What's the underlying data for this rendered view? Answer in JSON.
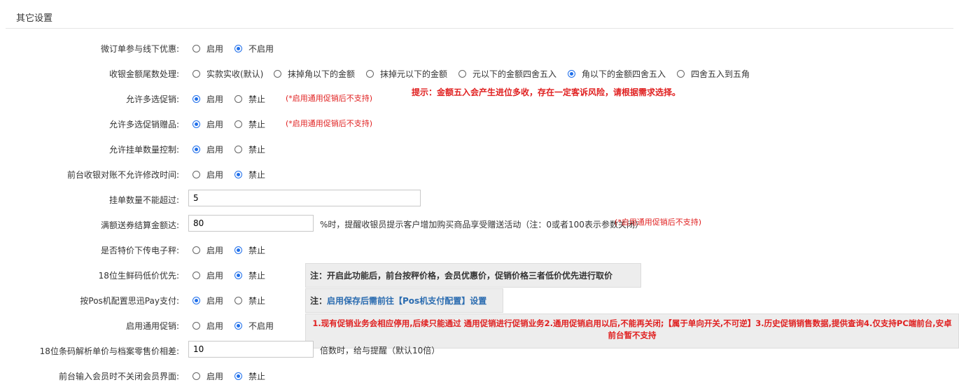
{
  "section": {
    "title": "其它设置"
  },
  "colors": {
    "accent": "#1f6feb",
    "warning": "#e02020",
    "note_bg": "#ededed",
    "link": "#2b6cb0"
  },
  "rows": {
    "weiding": {
      "label": "微订单参与线下优惠:",
      "opt1": "启用",
      "opt2": "不启用"
    },
    "rounding": {
      "label": "收银金额尾数处理:",
      "opt1": "实款实收(默认)",
      "opt2": "抹掉角以下的金额",
      "opt3": "抹掉元以下的金额",
      "opt4": "元以下的金额四舍五入",
      "opt5": "角以下的金额四舍五入",
      "opt6": "四舍五入到五角"
    },
    "multi_promo": {
      "label": "允许多选促销:",
      "opt1": "启用",
      "opt2": "禁止",
      "note": "(*启用通用促销后不支持)"
    },
    "multi_gift": {
      "label": "允许多选促销赠品:",
      "opt1": "启用",
      "opt2": "禁止",
      "note": "(*启用通用促销后不支持)"
    },
    "hang_qty": {
      "label": "允许挂单数量控制:",
      "opt1": "启用",
      "opt2": "禁止"
    },
    "reconcile": {
      "label": "前台收银对账不允许修改时间:",
      "opt1": "启用",
      "opt2": "禁止"
    },
    "hang_max": {
      "label": "挂单数量不能超过:",
      "value": "5"
    },
    "coupon": {
      "label": "满额送券结算金额达:",
      "value": "80",
      "suffix": "%时，提醒收银员提示客户增加购买商品享受赠送活动（注：0或者100表示参数关闭）",
      "note": "(*启用通用促销后不支持)"
    },
    "special_scale": {
      "label": "是否特价下传电子秤:",
      "opt1": "启用",
      "opt2": "禁止"
    },
    "fresh18": {
      "label": "18位生鲜码低价优先:",
      "opt1": "启用",
      "opt2": "禁止",
      "note": "注：开启此功能后，前台按秤价格，会员优惠价，促销价格三者低价优先进行取价"
    },
    "pos_pay": {
      "label": "按Pos机配置思迅Pay支付:",
      "opt1": "启用",
      "opt2": "禁止",
      "note_prefix": "注：",
      "note_link": "启用保存后需前往【Pos机支付配置】设置"
    },
    "general_promo": {
      "label": "启用通用促销:",
      "opt1": "启用",
      "opt2": "不启用",
      "note": "1.现有促销业务会相应停用,后续只能通过 通用促销进行促销业务2.通用促销启用以后,不能再关闭;【属于单向开关,不可逆】3.历史促销销售数据,提供查询4.仅支持PC端前台,安卓前台暂不支持"
    },
    "barcode_diff": {
      "label": "18位条码解析单价与档案零售价相差:",
      "value": "10",
      "suffix": "倍数时，给与提醒（默认10倍）"
    },
    "member_screen": {
      "label": "前台输入会员时不关闭会员界面:",
      "opt1": "启用",
      "opt2": "禁止"
    }
  },
  "tip": "提示：金额五入会产生进位多收，存在一定客诉风险，请根据需求选择。"
}
